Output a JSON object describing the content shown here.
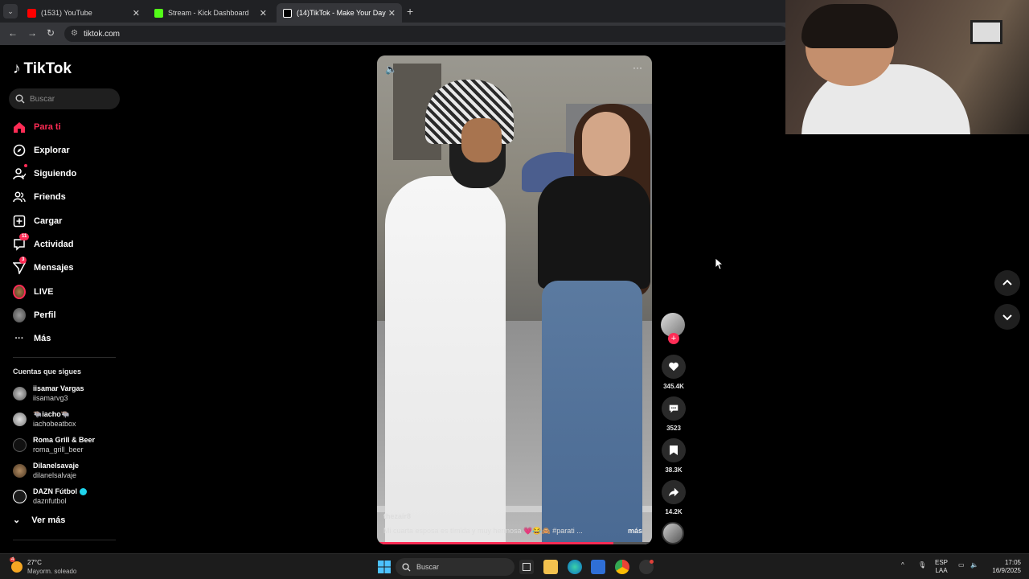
{
  "browser": {
    "tabs": [
      {
        "label": "(1531) YouTube",
        "favicon_color": "#ff0000"
      },
      {
        "label": "Stream - Kick Dashboard",
        "favicon_color": "#53fc18"
      },
      {
        "label": "(14)TikTok - Make Your Day",
        "favicon_color": "#ffffff"
      }
    ],
    "url": "tiktok.com"
  },
  "sidebar": {
    "logo": "TikTok",
    "search_placeholder": "Buscar",
    "nav": [
      {
        "label": "Para ti",
        "icon": "home-icon",
        "active": true
      },
      {
        "label": "Explorar",
        "icon": "compass-icon"
      },
      {
        "label": "Siguiendo",
        "icon": "following-icon"
      },
      {
        "label": "Friends",
        "icon": "friends-icon"
      },
      {
        "label": "Cargar",
        "icon": "upload-icon"
      },
      {
        "label": "Actividad",
        "icon": "activity-icon",
        "badge": "11"
      },
      {
        "label": "Mensajes",
        "icon": "messages-icon",
        "badge": "3"
      },
      {
        "label": "LIVE",
        "icon": "live-icon"
      },
      {
        "label": "Perfil",
        "icon": "profile-icon"
      },
      {
        "label": "Más",
        "icon": "more-icon"
      }
    ],
    "following_title": "Cuentas que sigues",
    "following": [
      {
        "name": "iisamar Vargas",
        "handle": "iisamarvg3"
      },
      {
        "name": "🐃iacho🐃",
        "handle": "iachobeatbox"
      },
      {
        "name": "Roma Grill & Beer",
        "handle": "roma_grill_beer"
      },
      {
        "name": "Dilanelsavaje",
        "handle": "dilanelsalvaje"
      },
      {
        "name": "DAZN Fútbol",
        "handle": "daznfutbol"
      }
    ],
    "see_more": "Ver más"
  },
  "video": {
    "author": "thezair8",
    "caption": "Mi cuarta esposa es tímida y muy hermosa 💗😂🙈 #parati ...",
    "more": "más",
    "progress": 0.86
  },
  "actions": {
    "likes": "345.4K",
    "comments": "3523",
    "saves": "38.3K",
    "shares": "14.2K"
  },
  "taskbar": {
    "temperature": "27°C",
    "weather": "Mayorm. soleado",
    "weather_badge": "4",
    "search": "Buscar",
    "lang_top": "ESP",
    "lang_bottom": "LAA",
    "time": "17:05",
    "date": "16/9/2025"
  },
  "colors": {
    "accent": "#fe2c55"
  }
}
